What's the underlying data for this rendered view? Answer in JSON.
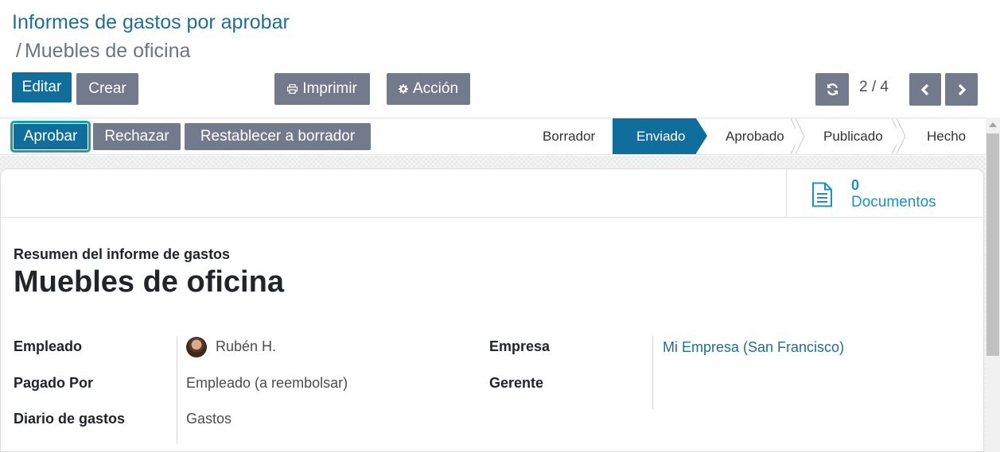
{
  "breadcrumb": {
    "parent": "Informes de gastos por aprobar",
    "separator": "/",
    "current": "Muebles de oficina"
  },
  "toolbar": {
    "edit_label": "Editar",
    "create_label": "Crear",
    "print_label": "Imprimir",
    "action_label": "Acción"
  },
  "pager": {
    "value": "2 / 4"
  },
  "statusbar": {
    "approve_label": "Aprobar",
    "reject_label": "Rechazar",
    "reset_label": "Restablecer a borrador",
    "stages": [
      "Borrador",
      "Enviado",
      "Aprobado",
      "Publicado",
      "Hecho"
    ],
    "active_stage": "Enviado"
  },
  "smart_button": {
    "value": "0",
    "label": "Documentos"
  },
  "form": {
    "subtitle": "Resumen del informe de gastos",
    "title": "Muebles de oficina",
    "fields": {
      "employee_label": "Empleado",
      "employee_value": "Rubén H.",
      "paid_by_label": "Pagado Por",
      "paid_by_value": "Empleado (a reembolsar)",
      "journal_label": "Diario de gastos",
      "journal_value": "Gastos",
      "company_label": "Empresa",
      "company_value": "Mi Empresa (San Francisco)",
      "manager_label": "Gerente"
    }
  },
  "colors": {
    "primary": "#0f6e9c",
    "secondary": "#737a8c",
    "link": "#1f6f93",
    "focus_outline": "#17a2a2"
  },
  "icons": {
    "print": "printer-icon",
    "action": "gear-icon",
    "refresh": "refresh-icon",
    "prev": "chevron-left-icon",
    "next": "chevron-right-icon",
    "documents": "document-icon"
  }
}
